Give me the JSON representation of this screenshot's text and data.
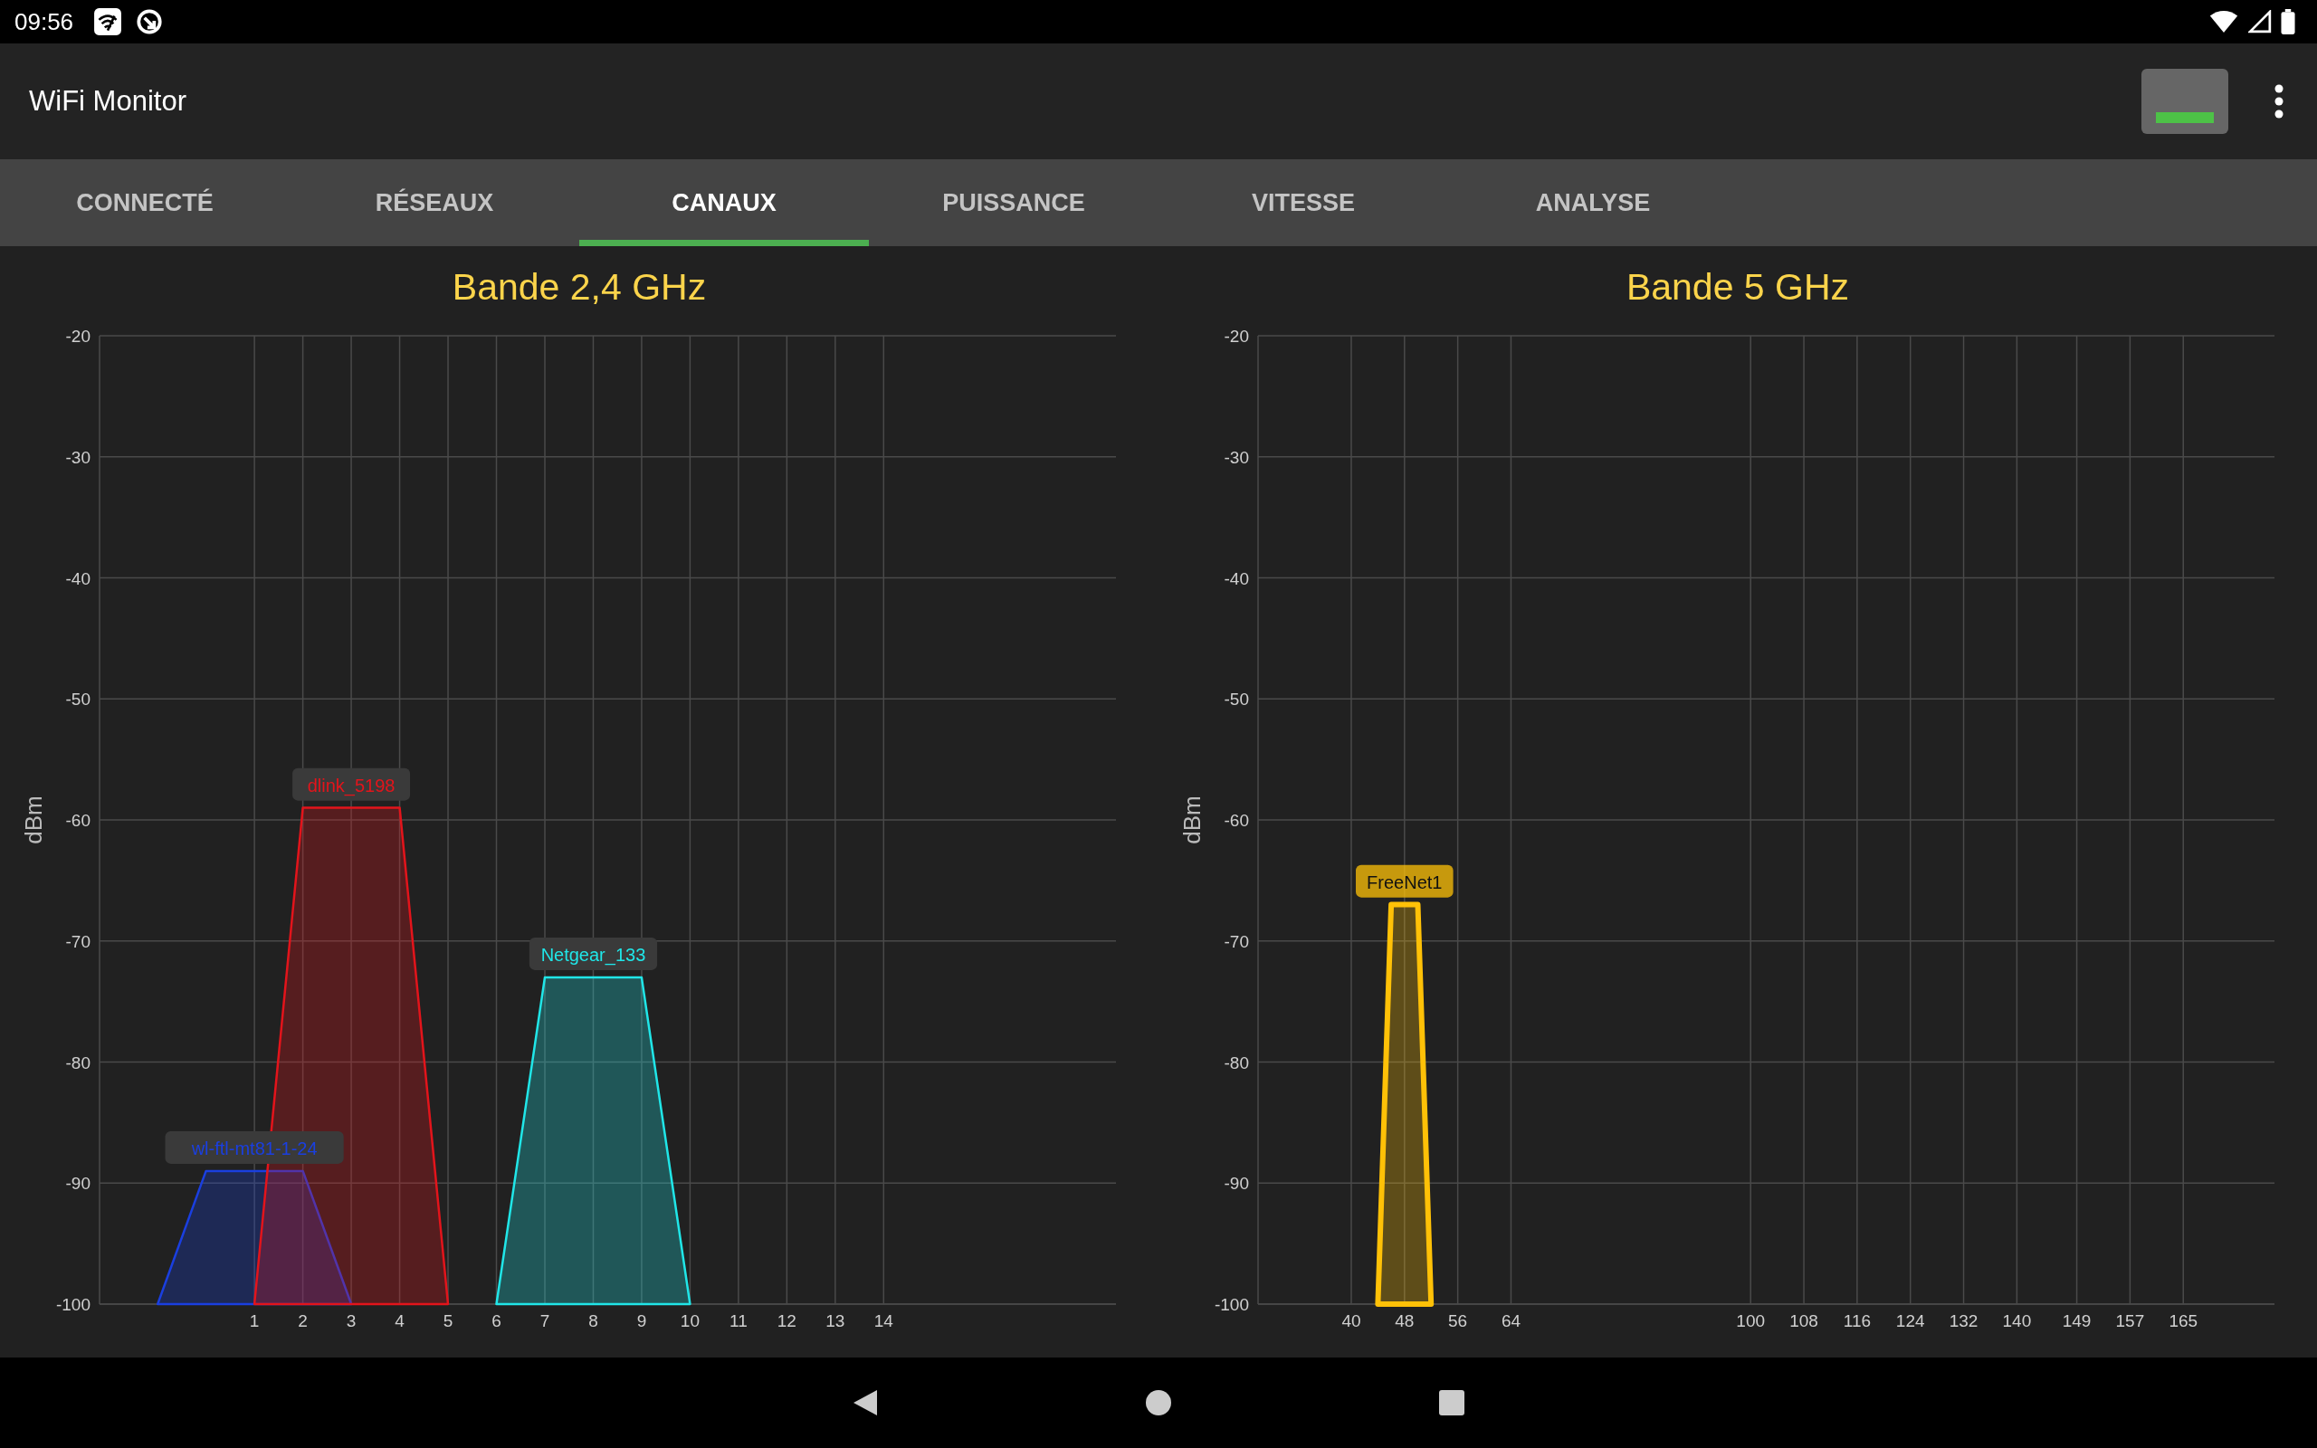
{
  "status_bar": {
    "time": "09:56"
  },
  "app_bar": {
    "title": "WiFi Monitor"
  },
  "tabs": [
    {
      "label": "CONNECTÉ",
      "selected": false
    },
    {
      "label": "RÉSEAUX",
      "selected": false
    },
    {
      "label": "CANAUX",
      "selected": true
    },
    {
      "label": "PUISSANCE",
      "selected": false
    },
    {
      "label": "VITESSE",
      "selected": false
    },
    {
      "label": "ANALYSE",
      "selected": false
    }
  ],
  "bands": [
    {
      "title": "Bande 2,4 GHz",
      "networks": [
        {
          "connected": false
        },
        {
          "connected": false
        },
        {
          "connected": false
        }
      ],
      "chart_data": {
        "type": "area",
        "ylabel": "dBm",
        "grid": true,
        "x": [
          -1,
          0,
          1,
          2,
          3,
          4,
          5,
          6,
          7,
          8,
          9,
          10
        ],
        "xlim": [
          -2.2,
          18.8
        ],
        "ylim": [
          -100,
          -20
        ],
        "xticks": [
          1,
          2,
          3,
          4,
          5,
          6,
          7,
          8,
          9,
          10,
          11,
          12,
          13,
          14
        ],
        "yticks": [
          -20,
          -30,
          -40,
          -50,
          -60,
          -70,
          -80,
          -90,
          -100
        ],
        "series": [
          {
            "name": "wl-ftl-mt81-1-24",
            "color": "#1a3fe0",
            "values": [
              -100,
              -89,
              -89,
              -89,
              -100,
              null,
              null,
              null,
              null,
              null,
              null,
              null
            ]
          },
          {
            "name": "dlink_5198",
            "color": "#e3141b",
            "values": [
              null,
              null,
              -100,
              -59,
              -59,
              -59,
              -100,
              null,
              null,
              null,
              null,
              null
            ]
          },
          {
            "name": "Netgear_133",
            "color": "#20e6e8",
            "values": [
              null,
              null,
              null,
              null,
              null,
              null,
              null,
              -100,
              -73,
              -73,
              -73,
              -100
            ]
          }
        ]
      }
    },
    {
      "title": "Bande 5 GHz",
      "networks": [
        {
          "connected": true
        }
      ],
      "chart_data": {
        "type": "area",
        "ylabel": "dBm",
        "grid": true,
        "x": [
          44,
          46,
          50,
          52
        ],
        "xlim": [
          26,
          178.7
        ],
        "ylim": [
          -100,
          -20
        ],
        "xticks": [
          40,
          48,
          56,
          64,
          100,
          108,
          116,
          124,
          132,
          140,
          149,
          157,
          165
        ],
        "yticks": [
          -20,
          -30,
          -40,
          -50,
          -60,
          -70,
          -80,
          -90,
          -100
        ],
        "series": [
          {
            "name": "FreeNet1",
            "color": "#ffc107",
            "values": [
              -100,
              -67,
              -67,
              -100
            ]
          }
        ]
      }
    }
  ]
}
